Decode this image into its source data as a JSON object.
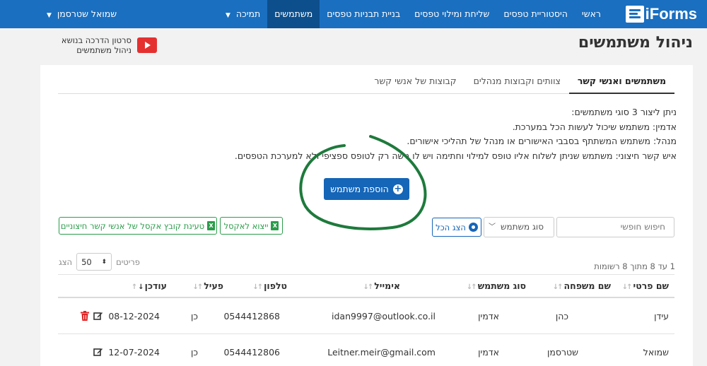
{
  "nav": {
    "logo": "iForms",
    "items": [
      {
        "label": "ראשי",
        "active": false,
        "dropdown": false
      },
      {
        "label": "היסטוריית טפסים",
        "active": false,
        "dropdown": false
      },
      {
        "label": "שליחת ומילוי טפסים",
        "active": false,
        "dropdown": false
      },
      {
        "label": "בניית תבניות טפסים",
        "active": false,
        "dropdown": false
      },
      {
        "label": "משתמשים",
        "active": true,
        "dropdown": false
      },
      {
        "label": "תמיכה",
        "active": false,
        "dropdown": true
      }
    ],
    "user": "שמואל שטרסמן",
    "colors": {
      "navbar": "#1a6fc0",
      "active": "#0d4f8c"
    }
  },
  "page": {
    "title": "ניהול משתמשים",
    "tutorial_line1": "סרטון הדרכה בנושא",
    "tutorial_line2": "ניהול משתמשים",
    "tutorial_icon": "youtube-play-icon"
  },
  "tabs": [
    {
      "label": "משתמשים ואנשי קשר",
      "active": true
    },
    {
      "label": "צוותים וקבוצות מנהלים",
      "active": false
    },
    {
      "label": "קבוצות של אנשי קשר",
      "active": false
    }
  ],
  "info": {
    "line1": "ניתן ליצור 3 סוגי משתמשים:",
    "line2": "אדמין: משתמש שיכול לעשות הכל במערכת.",
    "line3": "מנהל: משתמש המשתתף בסבבי האישורים או מנהל של תהליכי אישורים.",
    "line4": "איש קשר חיצוני: משתמש שניתן לשלוח אליו טופס למילוי וחתימה ויש לו גישה רק לטופס ספציפי ולא למערכת הטפסים."
  },
  "actions": {
    "add_user": "הוספת משתמש",
    "search_placeholder": "חיפוש חופשי",
    "user_type": "סוג משתמש",
    "show_all": "הצג הכל",
    "export_excel": "ייצוא לאקסל",
    "import_excel": "טעינת קובץ אקסל של אנשי קשר חיצוניים"
  },
  "pagination": {
    "show_label": "הצג",
    "page_size": "50",
    "items_label": "פריטים",
    "records_text": "1 עד 8 מתוך 8 רשומות"
  },
  "table": {
    "headers": [
      "שם פרטי",
      "שם משפחה",
      "סוג משתמש",
      "אימייל",
      "טלפון",
      "פעיל",
      "עודכן"
    ],
    "rows": [
      {
        "first": "עידן",
        "last": "כהן",
        "type": "אדמין",
        "email": "idan9997@outlook.co.il",
        "phone": "0544412868",
        "active": "כן",
        "updated": "08-12-2024",
        "deletable": true
      },
      {
        "first": "שמואל",
        "last": "שטרסמן",
        "type": "אדמין",
        "email": "Leitner.meir@gmail.com",
        "phone": "0544412806",
        "active": "כן",
        "updated": "12-07-2024",
        "deletable": false
      }
    ]
  },
  "annotation": {
    "color": "#1e7a3c"
  }
}
